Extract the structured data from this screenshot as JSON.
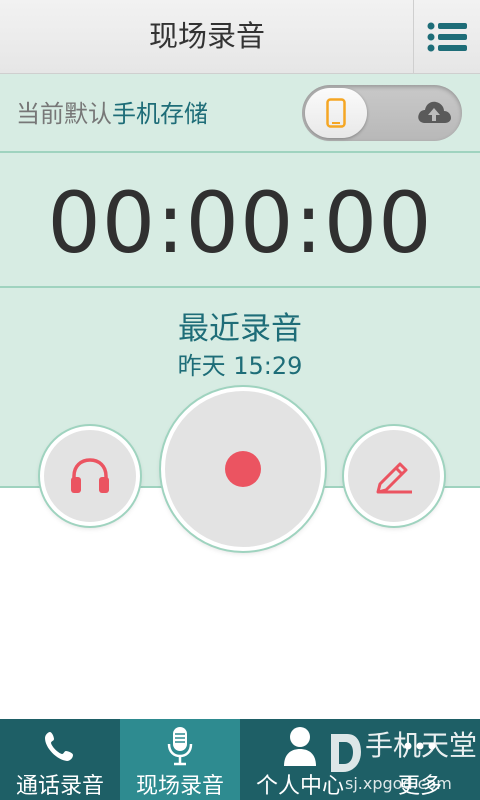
{
  "header": {
    "title": "现场录音",
    "menu_icon": "menu-list-icon"
  },
  "storage": {
    "prefix": "当前默认",
    "selected": "手机存储",
    "toggle_left_icon": "phone-icon",
    "toggle_right_icon": "cloud-upload-icon"
  },
  "timer": {
    "value": "00:00:00"
  },
  "recent": {
    "title": "最近录音",
    "time": "昨天 15:29"
  },
  "controls": {
    "left_icon": "headphones-icon",
    "center_icon": "record-icon",
    "right_icon": "pencil-icon"
  },
  "nav": {
    "tabs": [
      {
        "label": "通话录音",
        "icon": "phone-handset-icon"
      },
      {
        "label": "现场录音",
        "icon": "microphone-icon"
      },
      {
        "label": "个人中心",
        "icon": "person-icon"
      },
      {
        "label": "更多",
        "icon": "more-dots-icon"
      }
    ]
  },
  "watermark": {
    "main": "手机天堂",
    "sub": "sj.xpgod.com"
  },
  "colors": {
    "accent": "#1e6d78",
    "panel": "#d7ece3",
    "record": "#eb5461",
    "orange": "#f5a623",
    "nav_bg": "#1e5f66",
    "nav_active": "#2e8b90"
  }
}
